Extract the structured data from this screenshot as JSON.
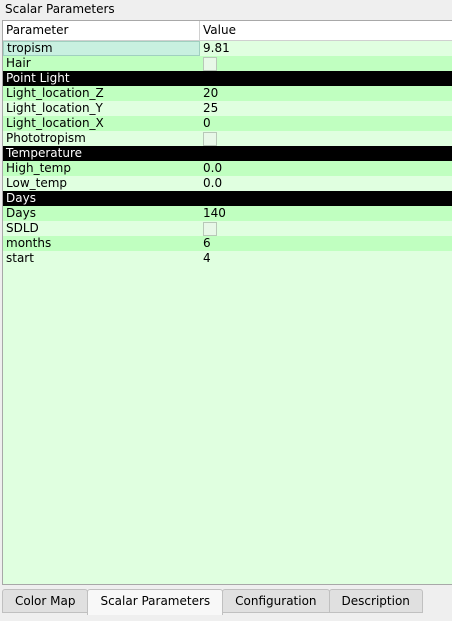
{
  "title": "Scalar Parameters",
  "columns": {
    "parameter": "Parameter",
    "value": "Value"
  },
  "rows": [
    {
      "type": "param",
      "name": "tropism",
      "value": "9.81",
      "style": "light",
      "selected": true
    },
    {
      "type": "param",
      "name": "Hair",
      "checkbox": false,
      "style": "dark"
    },
    {
      "type": "section",
      "name": "Point Light"
    },
    {
      "type": "param",
      "name": "Light_location_Z",
      "value": "20",
      "style": "dark"
    },
    {
      "type": "param",
      "name": "Light_location_Y",
      "value": "25",
      "style": "light"
    },
    {
      "type": "param",
      "name": "Light_location_X",
      "value": "0",
      "style": "dark"
    },
    {
      "type": "param",
      "name": "Phototropism",
      "checkbox": false,
      "style": "light"
    },
    {
      "type": "section",
      "name": "Temperature"
    },
    {
      "type": "param",
      "name": "High_temp",
      "value": "0.0",
      "style": "dark"
    },
    {
      "type": "param",
      "name": "Low_temp",
      "value": "0.0",
      "style": "light"
    },
    {
      "type": "section",
      "name": "Days"
    },
    {
      "type": "param",
      "name": "Days",
      "value": "140",
      "style": "dark"
    },
    {
      "type": "param",
      "name": "SDLD",
      "checkbox": false,
      "style": "light"
    },
    {
      "type": "param",
      "name": "months",
      "value": "6",
      "style": "dark"
    },
    {
      "type": "param",
      "name": "start",
      "value": "4",
      "style": "light"
    }
  ],
  "tabs": [
    {
      "label": "Color Map"
    },
    {
      "label": "Scalar Parameters",
      "active": true
    },
    {
      "label": "Configuration"
    },
    {
      "label": "Description"
    }
  ]
}
